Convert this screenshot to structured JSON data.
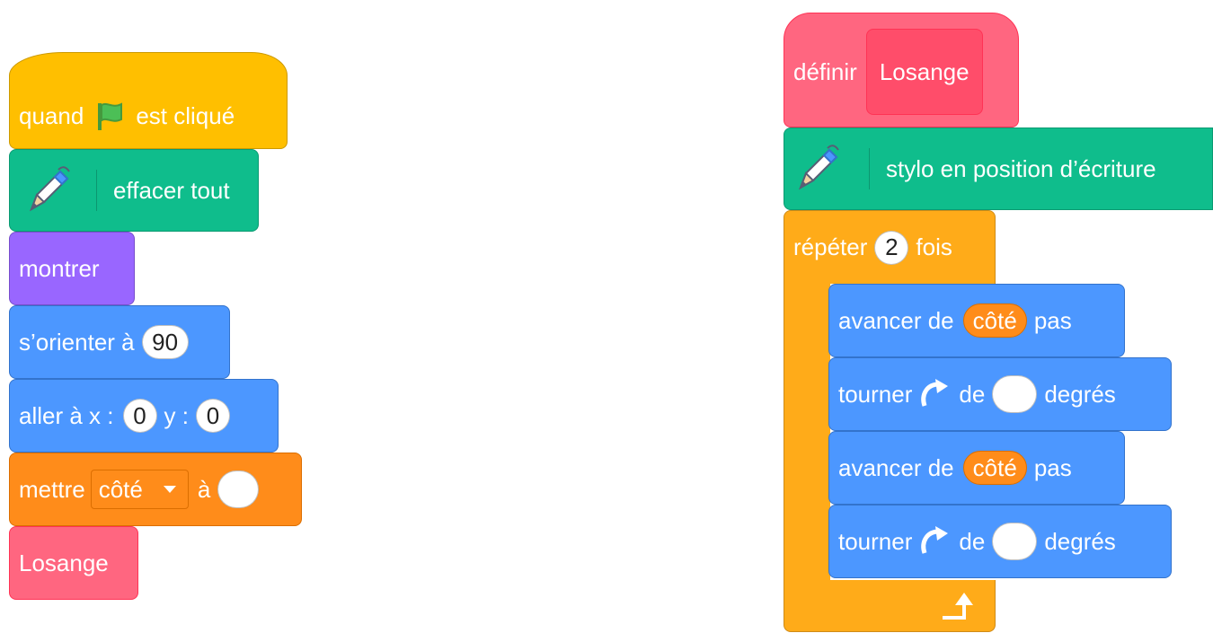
{
  "left_script": {
    "hat": {
      "when_label": "quand",
      "clicked_label": "est cliqué",
      "icon": "green-flag-icon"
    },
    "erase_all": {
      "label": "effacer tout",
      "icon": "pen-icon"
    },
    "show": {
      "label": "montrer"
    },
    "point_direction": {
      "label": "s’orienter à",
      "value": "90"
    },
    "go_to": {
      "label": "aller à x :",
      "x_value": "0",
      "y_label": "y :",
      "y_value": "0"
    },
    "set_var": {
      "label": "mettre",
      "variable": "côté",
      "to_label": "à",
      "value": ""
    },
    "call": {
      "label": "Losange"
    }
  },
  "right_script": {
    "define": {
      "label": "définir",
      "name": "Losange"
    },
    "pen_down": {
      "label": "stylo en position d’écriture",
      "icon": "pen-icon"
    },
    "repeat": {
      "label": "répéter",
      "count": "2",
      "times_label": "fois"
    },
    "body": [
      {
        "type": "move",
        "label": "avancer de",
        "variable": "côté",
        "unit": "pas"
      },
      {
        "type": "turn",
        "label": "tourner",
        "of_label": "de",
        "value": "",
        "unit": "degrés",
        "icon": "turn-right-icon"
      },
      {
        "type": "move",
        "label": "avancer de",
        "variable": "côté",
        "unit": "pas"
      },
      {
        "type": "turn",
        "label": "tourner",
        "of_label": "de",
        "value": "",
        "unit": "degrés",
        "icon": "turn-right-icon"
      }
    ]
  },
  "colors": {
    "events": "#ffbf00",
    "pen": "#0fbd8c",
    "looks": "#9966ff",
    "motion": "#4c97ff",
    "variables": "#ff8c1a",
    "my_blocks": "#ff6680",
    "control": "#ffab19"
  }
}
